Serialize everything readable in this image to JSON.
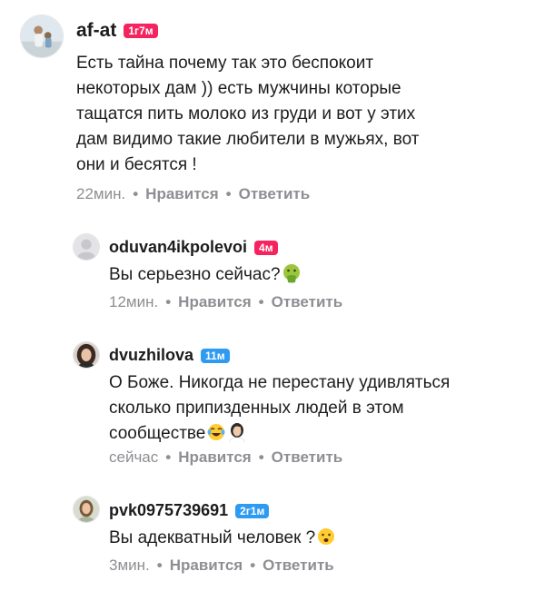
{
  "comments": [
    {
      "username": "af-at",
      "badge": "1г7м",
      "badge_color": "#f5245e",
      "lines": [
        "Есть тайна почему так это беспокоит",
        "некоторых дам )) есть мужчины которые",
        "тащатся пить молоко из груди и вот у этих",
        "дам видимо такие любители в мужьях, вот",
        "они и бесятся !"
      ],
      "time": "22мин.",
      "like_label": "Нравится",
      "reply_label": "Ответить"
    },
    {
      "username": "oduvan4ikpolevoi",
      "badge": "4м",
      "badge_color": "#f5245e",
      "lines": [
        "Вы серьезно сейчас?"
      ],
      "emojis": [
        "vomiting-face"
      ],
      "time": "12мин.",
      "like_label": "Нравится",
      "reply_label": "Ответить"
    },
    {
      "username": "dvuzhilova",
      "badge": "11м",
      "badge_color": "#2f9bf0",
      "lines": [
        "О Боже. Никогда не перестану удивляться",
        "сколько припизденных людей в этом",
        "сообществе"
      ],
      "emojis": [
        "tears-of-joy-face",
        "facepalm-woman"
      ],
      "time": "сейчас",
      "like_label": "Нравится",
      "reply_label": "Ответить"
    },
    {
      "username": "pvk0975739691",
      "badge": "2г1м",
      "badge_color": "#2f9bf0",
      "lines": [
        "Вы адекватный человек ?"
      ],
      "emojis": [
        "frowning-face"
      ],
      "time": "3мин.",
      "like_label": "Нравится",
      "reply_label": "Ответить"
    }
  ]
}
